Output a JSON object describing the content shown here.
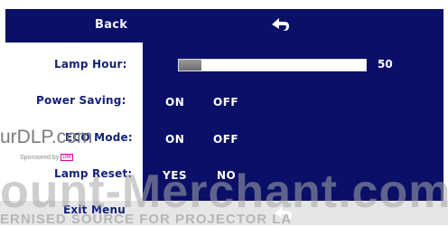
{
  "menu": {
    "back_label": "Back",
    "lamp_hour": {
      "label": "Lamp Hour:",
      "value": "50",
      "level_fraction": 0.12
    },
    "power_saving": {
      "label": "Power Saving:",
      "options": [
        "ON",
        "OFF"
      ]
    },
    "eco_mode": {
      "label": "ECO Mode:",
      "options": [
        "ON",
        "OFF"
      ]
    },
    "lamp_reset": {
      "label": "Lamp Reset:",
      "options": [
        "YES",
        "NO"
      ]
    },
    "exit_label": "Exit Menu"
  },
  "watermark": {
    "url": "urDLP.com",
    "sponsored": "Sponsored by",
    "sponsor_logo": "DM",
    "big": "ount-Merchant.com",
    "small": "ERNISED SOURCE FOR PROJECTOR LA"
  },
  "icons": {
    "back": "return-arrow-icon",
    "exit": "return-arrow-icon"
  },
  "colors": {
    "panel": "#0a1068",
    "label_text": "#15217a",
    "option_text": "#ffffff"
  }
}
